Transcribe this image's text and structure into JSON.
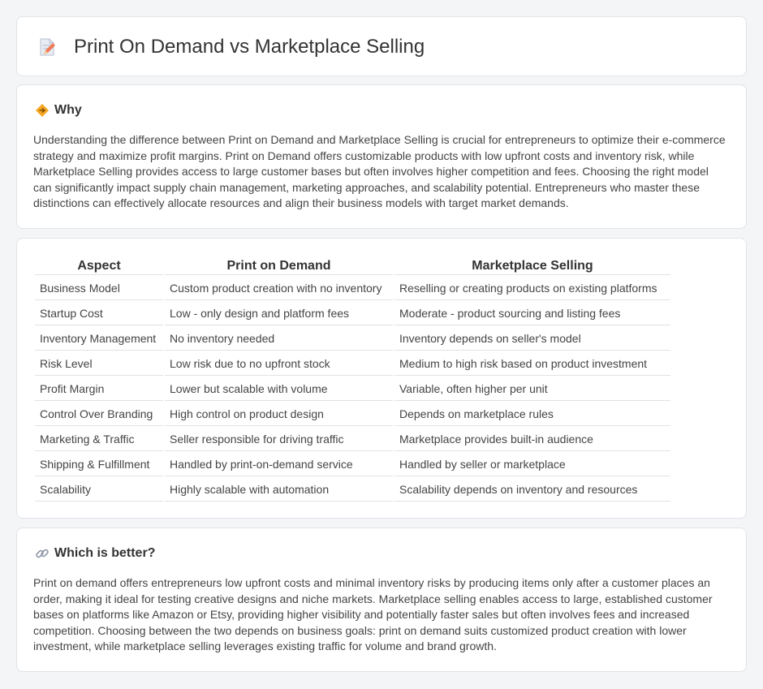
{
  "header": {
    "title": "Print On Demand vs Marketplace Selling",
    "icon": "document-pencil-icon"
  },
  "why": {
    "icon": "diamond-arrows-icon",
    "title": "Why",
    "text": "Understanding the difference between Print on Demand and Marketplace Selling is crucial for entrepreneurs to optimize their e-commerce strategy and maximize profit margins. Print on Demand offers customizable products with low upfront costs and inventory risk, while Marketplace Selling provides access to large customer bases but often involves higher competition and fees. Choosing the right model can significantly impact supply chain management, marketing approaches, and scalability potential. Entrepreneurs who master these distinctions can effectively allocate resources and align their business models with target market demands."
  },
  "table": {
    "headers": [
      "Aspect",
      "Print on Demand",
      "Marketplace Selling"
    ],
    "rows": [
      [
        "Business Model",
        "Custom product creation with no inventory",
        "Reselling or creating products on existing platforms"
      ],
      [
        "Startup Cost",
        "Low - only design and platform fees",
        "Moderate - product sourcing and listing fees"
      ],
      [
        "Inventory Management",
        "No inventory needed",
        "Inventory depends on seller's model"
      ],
      [
        "Risk Level",
        "Low risk due to no upfront stock",
        "Medium to high risk based on product investment"
      ],
      [
        "Profit Margin",
        "Lower but scalable with volume",
        "Variable, often higher per unit"
      ],
      [
        "Control Over Branding",
        "High control on product design",
        "Depends on marketplace rules"
      ],
      [
        "Marketing & Traffic",
        "Seller responsible for driving traffic",
        "Marketplace provides built-in audience"
      ],
      [
        "Shipping & Fulfillment",
        "Handled by print-on-demand service",
        "Handled by seller or marketplace"
      ],
      [
        "Scalability",
        "Highly scalable with automation",
        "Scalability depends on inventory and resources"
      ]
    ]
  },
  "better": {
    "icon": "link-icon",
    "title": "Which is better?",
    "text": "Print on demand offers entrepreneurs low upfront costs and minimal inventory risks by producing items only after a customer places an order, making it ideal for testing creative designs and niche markets. Marketplace selling enables access to large, established customer bases on platforms like Amazon or Etsy, providing higher visibility and potentially faster sales but often involves fees and increased competition. Choosing between the two depends on business goals: print on demand suits customized product creation with lower investment, while marketplace selling leverages existing traffic for volume and brand growth."
  }
}
